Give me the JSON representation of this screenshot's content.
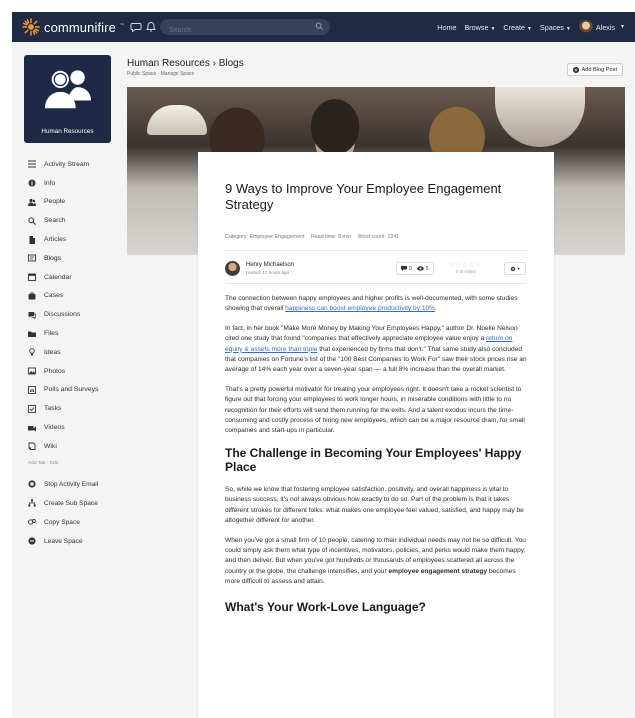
{
  "topbar": {
    "brand": "communifire",
    "brand_tm": "™",
    "search_placeholder": "Search",
    "nav": [
      {
        "label": "Home",
        "caret": false
      },
      {
        "label": "Browse",
        "caret": true
      },
      {
        "label": "Create",
        "caret": true
      },
      {
        "label": "Spaces",
        "caret": true
      }
    ],
    "user": "Alexis"
  },
  "space": {
    "name": "Human Resources"
  },
  "sidebar": {
    "items": [
      {
        "label": "Activity Stream",
        "icon": "list-icon"
      },
      {
        "label": "Info",
        "icon": "info-icon"
      },
      {
        "label": "People",
        "icon": "people-icon"
      },
      {
        "label": "Search",
        "icon": "search-icon"
      },
      {
        "label": "Articles",
        "icon": "document-icon"
      },
      {
        "label": "Blogs",
        "icon": "blog-icon"
      },
      {
        "label": "Calendar",
        "icon": "calendar-icon"
      },
      {
        "label": "Cases",
        "icon": "case-icon"
      },
      {
        "label": "Discussions",
        "icon": "chat-icon"
      },
      {
        "label": "Files",
        "icon": "folder-icon"
      },
      {
        "label": "Ideas",
        "icon": "lightbulb-icon"
      },
      {
        "label": "Photos",
        "icon": "photo-icon"
      },
      {
        "label": "Polls and Surveys",
        "icon": "poll-icon"
      },
      {
        "label": "Tasks",
        "icon": "task-icon"
      },
      {
        "label": "Videos",
        "icon": "video-icon"
      },
      {
        "label": "Wiki",
        "icon": "wiki-icon"
      }
    ],
    "add_tab": "Add Tab · Edit",
    "actions": [
      {
        "label": "Stop Activity Email",
        "icon": "stop-icon"
      },
      {
        "label": "Create Sub Space",
        "icon": "sitemap-icon"
      },
      {
        "label": "Copy Space",
        "icon": "copy-icon"
      },
      {
        "label": "Leave Space",
        "icon": "leave-icon"
      }
    ]
  },
  "header": {
    "breadcrumb": "Human Resources › Blogs",
    "sub": "Public Space · Manage Space",
    "add_button": "Add Blog Post"
  },
  "article": {
    "title": "9 Ways to Improve Your Employee Engagement Strategy",
    "category": "Category: Employee Engagement",
    "read_time": "Read time: 8 min",
    "word_count": "Word count: 2241",
    "author": "Henry Michaelson",
    "posted": "posted: 17 hours ago",
    "comments": "0",
    "views": "5",
    "stars": "☆☆☆☆☆",
    "votes": "0 (0 votes)",
    "p1_a": "The connection between happy employees and higher profits is well-documented, with some studies showing that overall ",
    "p1_link": "happiness can boost employee productivity by 10%",
    "p1_b": ".",
    "p2_a": "In fact, in her book \"Make More Money by Making Your Employees Happy,\" author Dr. Noelle Nelson cited one study that found \"companies that effectively appreciate employee value enjoy a ",
    "p2_link": "return on equity & assets more than triple",
    "p2_b": " that experienced by firms that don't.\" That same study also concluded that companies on Fortune's list of the \"100 Best Companies to Work For\" saw their stock prices rise an average of 14% each year over a seven-year span — a full 8% increase than the overall market.",
    "p3": "That's a pretty powerful motivator for treating your employees right. It doesn't take a rocket scientist to figure out that forcing your employees to work longer hours, in miserable conditions with little to no recognition for their efforts will send them running for the exits. And a talent exodus incurs the time-consuming and costly process of hiring new employees, which can be a major resource drain, for small companies and start-ups in particular.",
    "h2": "The Challenge in Becoming Your Employees' Happy Place",
    "p4": "So, while we know that fostering employee satisfaction, positivity, and overall happiness is vital to business success, it's not always obvious how exactly to do so. Part of the problem is that it takes different strokes for different folks: what makes one employee feel valued, satisfied, and happy may be altogether different for another.",
    "p5_a": "When you've got a small firm of 10 people, catering to their individual needs may not be so difficult. You could simply ask them what type of incentives, motivators, policies, and perks would make them happy, and then deliver. But when you've got hundreds or thousands of employees scattered all across the country or the globe, the challenge intensifies, and your ",
    "p5_bold": "employee engagement strategy",
    "p5_b": " becomes more difficult to assess and attain.",
    "h2b": "What's Your Work-Love Language?"
  },
  "colors": {
    "topbar": "#1f2a44",
    "space_card": "#1e2a45",
    "link": "#2f6fd0",
    "brand_sun": "#f29a2e"
  }
}
